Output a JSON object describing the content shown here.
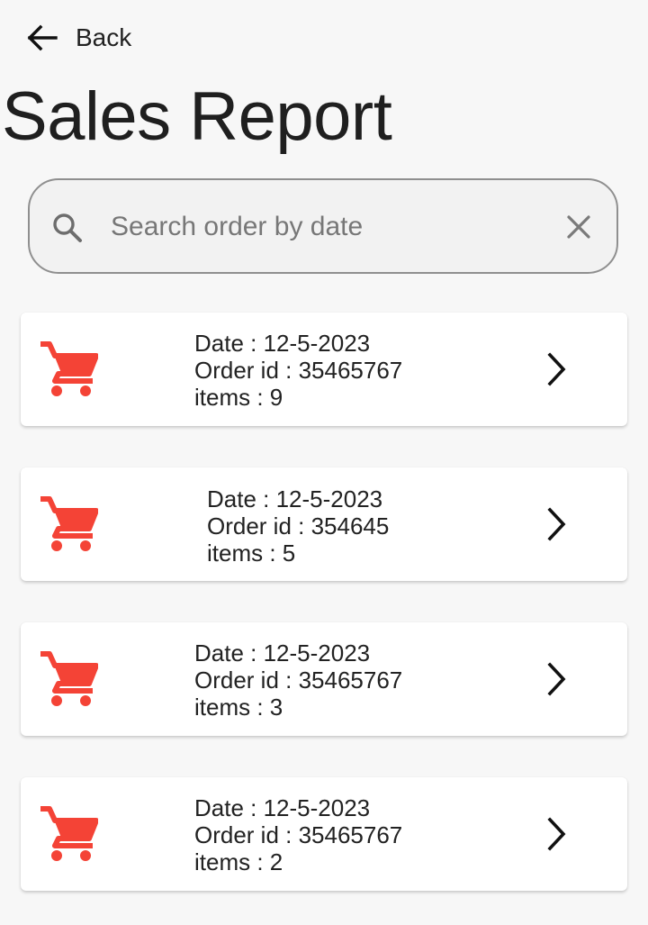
{
  "header": {
    "back_label": "Back",
    "title": "Sales Report"
  },
  "search": {
    "placeholder": "Search order by date",
    "value": ""
  },
  "colors": {
    "cart": "#f44336",
    "background": "#f7f7f7"
  },
  "icons": {
    "back": "arrow-left-icon",
    "search": "search-icon",
    "clear": "close-icon",
    "order": "shopping-cart-icon",
    "open": "chevron-right-icon"
  },
  "orders": [
    {
      "date": "Date : 12-5-2023",
      "order_id": "Order id : 35465767",
      "items": "items : 9"
    },
    {
      "date": "Date : 12-5-2023",
      "order_id": "Order id : 354645",
      "items": "items : 5"
    },
    {
      "date": "Date : 12-5-2023",
      "order_id": "Order id : 35465767",
      "items": "items : 3"
    },
    {
      "date": "Date : 12-5-2023",
      "order_id": "Order id : 35465767",
      "items": "items : 2"
    }
  ]
}
